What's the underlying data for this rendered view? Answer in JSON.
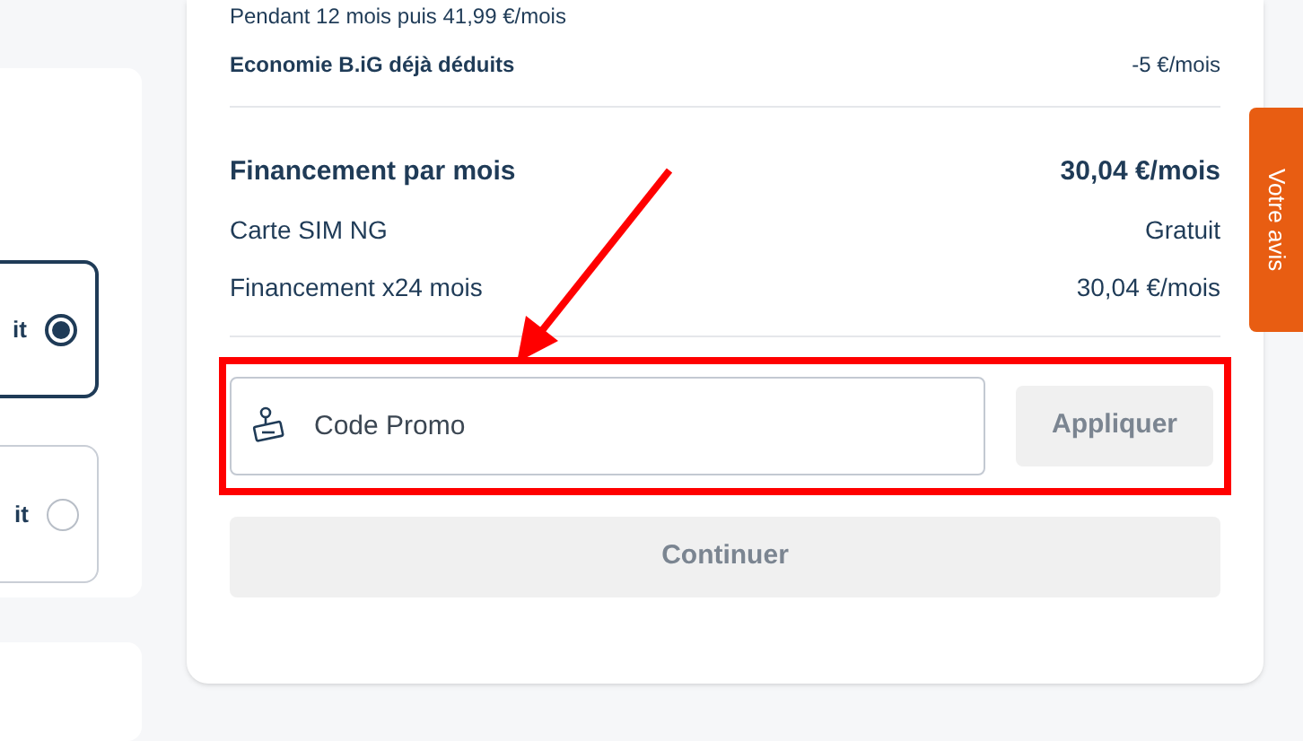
{
  "left_options": [
    {
      "label": "it",
      "selected": true
    },
    {
      "label": "it",
      "selected": false
    }
  ],
  "summary": {
    "promo_note": "Pendant 12 mois puis 41,99 €/mois",
    "discount": {
      "label": "Economie B.iG déjà déduits",
      "value": "-5 €/mois"
    },
    "financing": {
      "label": "Financement par mois",
      "value": "30,04 €/mois"
    },
    "rows": [
      {
        "label": "Carte SIM NG",
        "value": "Gratuit"
      },
      {
        "label": "Financement x24 mois",
        "value": "30,04 €/mois"
      }
    ],
    "promo_field": {
      "placeholder": "Code Promo"
    },
    "apply_button": {
      "label": "Appliquer",
      "disabled": true
    },
    "continue_button": {
      "label": "Continuer",
      "disabled": true
    }
  },
  "feedback_tab": {
    "label": "Votre avis"
  }
}
